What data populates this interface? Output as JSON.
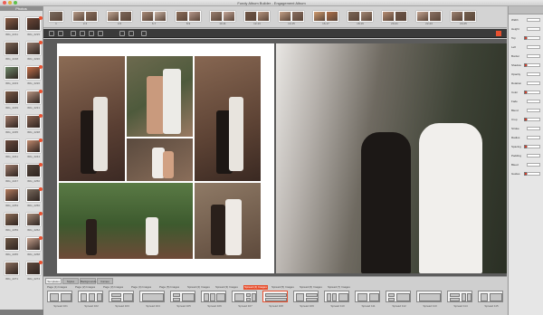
{
  "window": {
    "title": "Fundy Album Builder - Engagement Album"
  },
  "left_panel": {
    "header": "Photos",
    "thumbnails": [
      {
        "label": "IMG_2211",
        "color": "#8b5d45",
        "used": false
      },
      {
        "label": "IMG_2215",
        "color": "#6d4636",
        "used": true
      },
      {
        "label": "IMG_2218",
        "color": "#7d6656",
        "used": false
      },
      {
        "label": "IMG_2220",
        "color": "#93786a",
        "used": true
      },
      {
        "label": "IMG_2223",
        "color": "#6f8a6b",
        "used": false
      },
      {
        "label": "IMG_2226",
        "color": "#c4704a",
        "used": true
      },
      {
        "label": "IMG_2229",
        "color": "#7c5a45",
        "used": false
      },
      {
        "label": "IMG_2231",
        "color": "#b99683",
        "used": true
      },
      {
        "label": "IMG_2235",
        "color": "#a27a6a",
        "used": false
      },
      {
        "label": "IMG_2238",
        "color": "#8a6655",
        "used": true
      },
      {
        "label": "IMG_2241",
        "color": "#6a4a3c",
        "used": false
      },
      {
        "label": "IMG_2244",
        "color": "#c08a6e",
        "used": true
      },
      {
        "label": "IMG_2247",
        "color": "#9e7b6b",
        "used": false
      },
      {
        "label": "IMG_2250",
        "color": "#55473d",
        "used": true
      },
      {
        "label": "IMG_2253",
        "color": "#b57c5e",
        "used": false
      },
      {
        "label": "IMG_2256",
        "color": "#7a6b5e",
        "used": true
      },
      {
        "label": "IMG_2259",
        "color": "#8e6e58",
        "used": false
      },
      {
        "label": "IMG_2262",
        "color": "#a58a78",
        "used": true
      },
      {
        "label": "IMG_2265",
        "color": "#6f5846",
        "used": false
      },
      {
        "label": "IMG_2268",
        "color": "#c7a28f",
        "used": true
      },
      {
        "label": "IMG_2271",
        "color": "#8b6f5e",
        "used": false
      },
      {
        "label": "IMG_2274",
        "color": "#5f4a3e",
        "used": true
      }
    ]
  },
  "filmstrip": {
    "spreads": [
      {
        "num": "1",
        "colors": [
          "#7a6b5e"
        ]
      },
      {
        "num": "2-3",
        "colors": [
          "#b79b88",
          "#8a6e5c"
        ]
      },
      {
        "num": "4-5",
        "colors": [
          "#c2a896",
          "#7d675a"
        ]
      },
      {
        "num": "6-7",
        "colors": [
          "#a88a78",
          "#c9b3a4"
        ]
      },
      {
        "num": "8-9",
        "colors": [
          "#8d6e5a",
          "#b6978a"
        ]
      },
      {
        "num": "10-11",
        "colors": [
          "#9b8070",
          "#c4a698"
        ]
      },
      {
        "num": "12-13",
        "colors": [
          "#6f5545",
          "#b7957f"
        ]
      },
      {
        "num": "14-15",
        "colors": [
          "#c39f86",
          "#8a6f61"
        ]
      },
      {
        "num": "16-17",
        "colors": [
          "#d19c6f",
          "#b07048"
        ]
      },
      {
        "num": "18-19",
        "colors": [
          "#7b6656",
          "#a38775"
        ]
      },
      {
        "num": "20-21",
        "colors": [
          "#b88e74",
          "#6e5648"
        ]
      },
      {
        "num": "22-23",
        "colors": [
          "#c4a592",
          "#8c7264"
        ]
      },
      {
        "num": "24-25",
        "colors": [
          "#9d8272",
          "#74604f"
        ]
      }
    ]
  },
  "bottom_bar": {
    "tabs": [
      "Templates",
      "Styles",
      "Backgrounds",
      "Cameo"
    ],
    "template_groups": [
      "Page (1) Images",
      "Page (2) Images",
      "Page (3) Images",
      "Page (4) Images",
      "Page (5) Images",
      "Spread (2) Images",
      "Spread (3) Images",
      "Spread (4) Images",
      "Spread (5) Images",
      "Spread (6) Images",
      "Spread (7) Images"
    ],
    "highlighted_group": "Spread (4) Images",
    "templates": [
      {
        "label": "Spread 101"
      },
      {
        "label": "Spread 102"
      },
      {
        "label": "Spread 103"
      },
      {
        "label": "Spread 104"
      },
      {
        "label": "Spread 105"
      },
      {
        "label": "Spread 106"
      },
      {
        "label": "Spread 107"
      },
      {
        "label": "Spread 108"
      },
      {
        "label": "Spread 109"
      },
      {
        "label": "Spread 110"
      },
      {
        "label": "Spread 111"
      },
      {
        "label": "Spread 112"
      },
      {
        "label": "Spread 113"
      },
      {
        "label": "Spread 114"
      },
      {
        "label": "Spread 115"
      }
    ]
  },
  "right_panel": {
    "rows": [
      "Width",
      "Height",
      "Top",
      "Left",
      "Border",
      "Shadow",
      "Opacity",
      "Rotation",
      "Color",
      "Fade",
      "Blend",
      "Crop",
      "Stroke",
      "Radius",
      "Spacing",
      "Padding",
      "Bleed",
      "Guides"
    ]
  },
  "colors": {
    "accent": "#e8502f",
    "canvas": "#5c5c5c",
    "page": "#ffffff"
  }
}
